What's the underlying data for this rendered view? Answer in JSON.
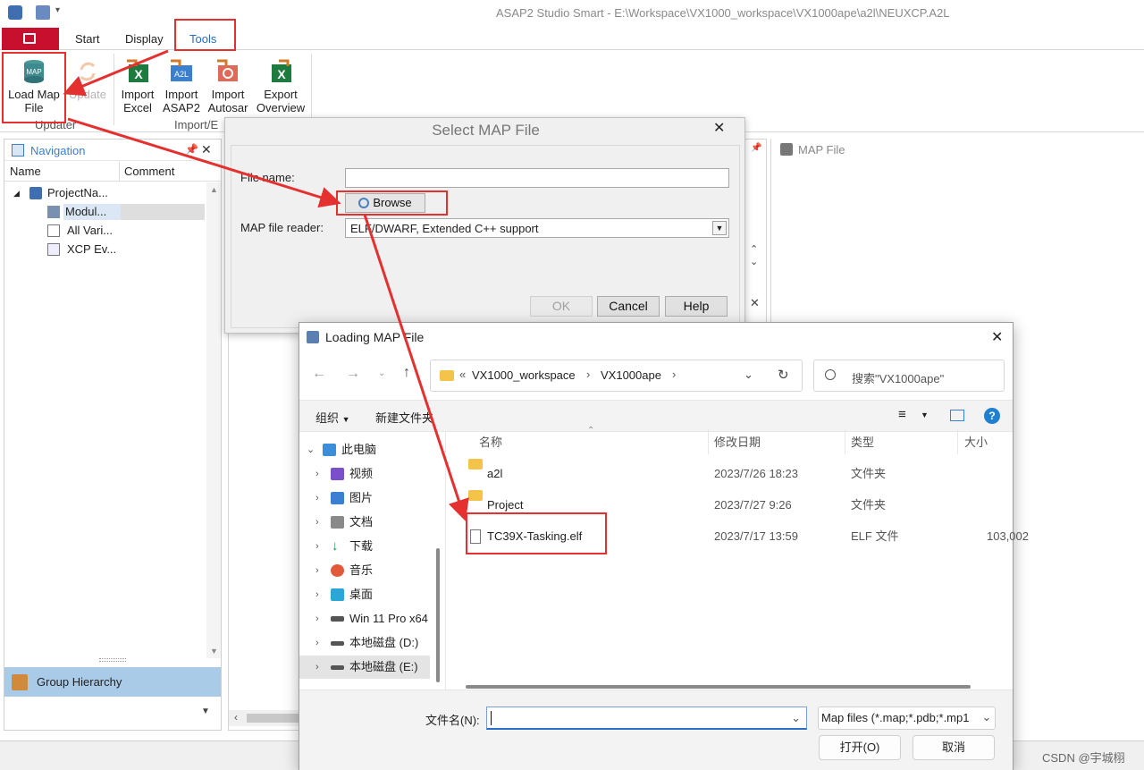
{
  "window": {
    "title": "ASAP2 Studio Smart - E:\\Workspace\\VX1000_workspace\\VX1000ape\\a2l\\NEUXCP.A2L"
  },
  "ribbon": {
    "tabs": [
      "Start",
      "Display",
      "Tools"
    ],
    "active_tab": "Tools",
    "buttons": {
      "load_map_line1": "Load Map",
      "load_map_line2": "File",
      "update": "Update",
      "import_excel_1": "Import",
      "import_excel_2": "Excel",
      "import_asap2_1": "Import",
      "import_asap2_2": "ASAP2",
      "import_autosar_1": "Import",
      "import_autosar_2": "Autosar",
      "export_overview_1": "Export",
      "export_overview_2": "Overview"
    },
    "groups": {
      "updater": "Updater",
      "import_export": "Import/E"
    }
  },
  "navigation": {
    "title": "Navigation",
    "columns": {
      "name": "Name",
      "comment": "Comment"
    },
    "tree": {
      "root": "ProjectNa...",
      "modules": "Modul...",
      "all_variables": "All Vari...",
      "xcp_events": "XCP Ev..."
    },
    "group_hierarchy": "Group Hierarchy"
  },
  "map_file_pane": {
    "title": "MAP File"
  },
  "select_map_dialog": {
    "title": "Select MAP File",
    "file_name_label": "File name:",
    "file_name_value": "",
    "browse_label": "Browse",
    "reader_label": "MAP file reader:",
    "reader_value": "ELF/DWARF, Extended C++ support",
    "ok_label": "OK",
    "cancel_label": "Cancel",
    "help_label": "Help"
  },
  "loading_dialog": {
    "title": "Loading MAP File",
    "breadcrumb": [
      "VX1000_workspace",
      "VX1000ape"
    ],
    "breadcrumb_prefix": "«",
    "search_placeholder": "搜索\"VX1000ape\"",
    "organize_label": "组织",
    "new_folder_label": "新建文件夹",
    "columns": {
      "name": "名称",
      "modified": "修改日期",
      "type": "类型",
      "size": "大小"
    },
    "sidebar": [
      {
        "label": "此电脑",
        "color": "#3b8ed8"
      },
      {
        "label": "视频",
        "color": "#7b4fc9"
      },
      {
        "label": "图片",
        "color": "#3a7fd0"
      },
      {
        "label": "文档",
        "color": "#8a8a8a"
      },
      {
        "label": "下载",
        "color": "#1f8f4e"
      },
      {
        "label": "音乐",
        "color": "#e05a3a"
      },
      {
        "label": "桌面",
        "color": "#2aa7d8"
      },
      {
        "label": "Win 11 Pro x64",
        "color": "#555555"
      },
      {
        "label": "本地磁盘 (D:)",
        "color": "#555555"
      },
      {
        "label": "本地磁盘 (E:)",
        "color": "#555555"
      }
    ],
    "files": [
      {
        "name": "a2l",
        "modified": "2023/7/26 18:23",
        "type": "文件夹",
        "size": ""
      },
      {
        "name": "Project",
        "modified": "2023/7/27 9:26",
        "type": "文件夹",
        "size": ""
      },
      {
        "name": "TC39X-Tasking.elf",
        "modified": "2023/7/17 13:59",
        "type": "ELF 文件",
        "size": "103,002"
      }
    ],
    "filename_label": "文件名(N):",
    "filename_value": "",
    "filter_value": "Map files (*.map;*.pdb;*.mp1",
    "open_label": "打开(O)",
    "cancel_label": "取消"
  },
  "watermark": "CSDN @宇城栩",
  "colors": {
    "annotation": "#e53030",
    "tools_tab": "#2b6cc4",
    "app_menu": "#c8102e",
    "selection": "#a9cbe8"
  }
}
